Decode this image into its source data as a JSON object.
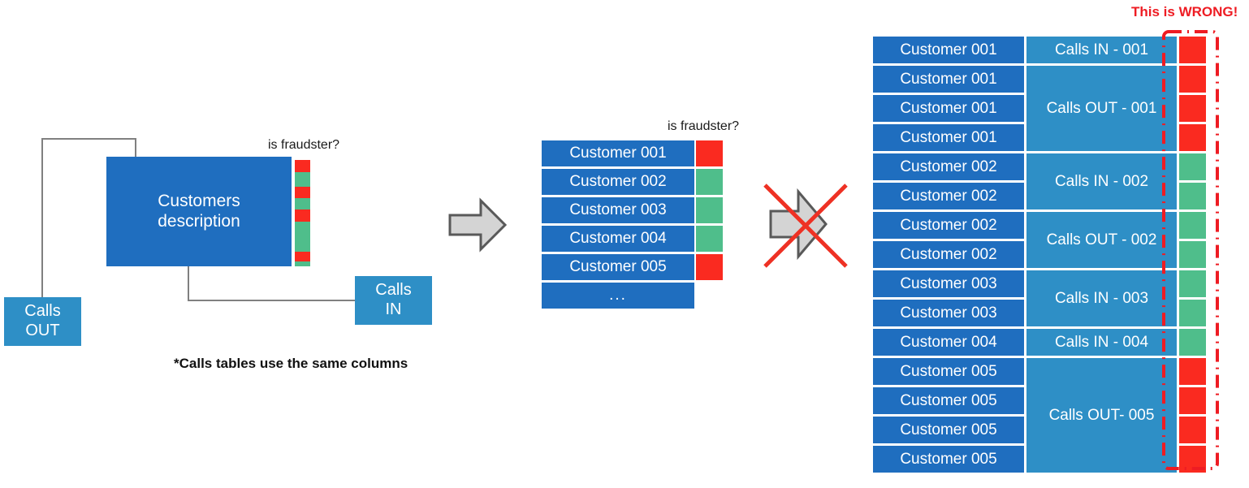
{
  "colors": {
    "dark_blue": "#1F6EBF",
    "light_blue": "#2E8FC6",
    "fraud_red": "#FA2A20",
    "fraud_green": "#4FBE8B",
    "connector_grey": "#808080",
    "arrow_fill": "#D4D4D4",
    "arrow_stroke": "#595959",
    "cross_red": "#EE3124",
    "warning_red": "#EE1C23"
  },
  "left_diagram": {
    "entities": {
      "customers": "Customers\ndescription",
      "calls_out": "Calls\nOUT",
      "calls_in": "Calls\nIN"
    },
    "fraud_label": "is fraudster?",
    "fraud_strip": [
      {
        "color": "#FA2A20",
        "height": 15
      },
      {
        "color": "#4FBE8B",
        "height": 18
      },
      {
        "color": "#FA2A20",
        "height": 14
      },
      {
        "color": "#4FBE8B",
        "height": 14
      },
      {
        "color": "#FA2A20",
        "height": 15
      },
      {
        "color": "#4FBE8B",
        "height": 37
      },
      {
        "color": "#FA2A20",
        "height": 12
      },
      {
        "color": "#4FBE8B",
        "height": 6
      }
    ],
    "footnote": "*Calls tables use the same columns"
  },
  "middle_table": {
    "fraud_label": "is fraudster?",
    "rows": [
      {
        "customer": "Customer 001",
        "fraud": "#FA2A20"
      },
      {
        "customer": "Customer 002",
        "fraud": "#4FBE8B"
      },
      {
        "customer": "Customer 003",
        "fraud": "#4FBE8B"
      },
      {
        "customer": "Customer 004",
        "fraud": "#4FBE8B"
      },
      {
        "customer": "Customer 005",
        "fraud": "#FA2A20"
      },
      {
        "customer": "...",
        "fraud": null
      }
    ]
  },
  "right_table": {
    "warning_label": "This is WRONG!",
    "customers": [
      "Customer 001",
      "Customer 001",
      "Customer 001",
      "Customer 001",
      "Customer 002",
      "Customer 002",
      "Customer 002",
      "Customer 002",
      "Customer 003",
      "Customer 003",
      "Customer 004",
      "Customer 005",
      "Customer 005",
      "Customer 005",
      "Customer 005"
    ],
    "call_groups": [
      {
        "label": "Calls IN - 001",
        "rows": 1
      },
      {
        "label": "Calls OUT - 001",
        "rows": 3
      },
      {
        "label": "Calls IN - 002",
        "rows": 2
      },
      {
        "label": "Calls OUT - 002",
        "rows": 2
      },
      {
        "label": "Calls IN - 003",
        "rows": 2
      },
      {
        "label": "Calls IN - 004",
        "rows": 1
      },
      {
        "label": "Calls OUT- 005",
        "rows": 4
      }
    ],
    "fraud_flags": [
      "#FA2A20",
      "#FA2A20",
      "#FA2A20",
      "#FA2A20",
      "#4FBE8B",
      "#4FBE8B",
      "#4FBE8B",
      "#4FBE8B",
      "#4FBE8B",
      "#4FBE8B",
      "#4FBE8B",
      "#FA2A20",
      "#FA2A20",
      "#FA2A20",
      "#FA2A20"
    ]
  },
  "arrows": {
    "transform_arrow": "right-arrow",
    "rejected_arrow": "right-arrow-crossed-out"
  }
}
